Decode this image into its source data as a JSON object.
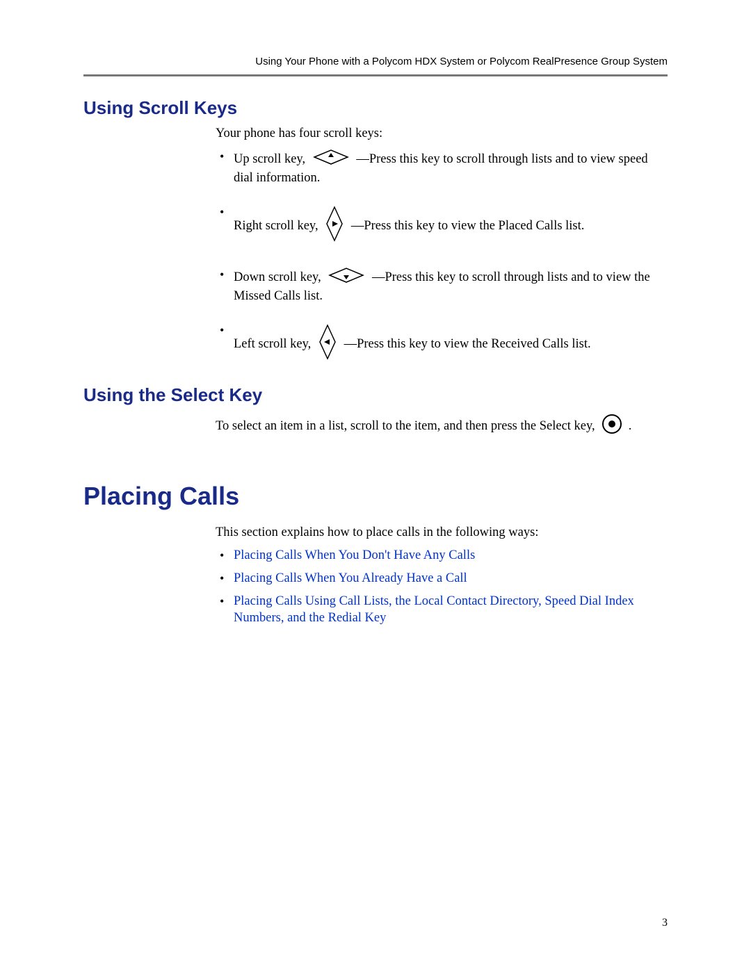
{
  "header": {
    "running_title": "Using Your Phone with a Polycom HDX System or Polycom RealPresence Group System"
  },
  "section_scroll": {
    "heading": "Using Scroll Keys",
    "intro": "Your phone has four scroll keys:",
    "items": [
      {
        "label_before": "Up scroll key,",
        "after": "—Press this key to scroll through lists and to view speed dial information."
      },
      {
        "label_before": "Right scroll key,",
        "after": "—Press this key to view the Placed Calls list."
      },
      {
        "label_before": "Down scroll key,",
        "after": "—Press this key to scroll through lists and to view the Missed Calls list."
      },
      {
        "label_before": "Left scroll key,",
        "after": "—Press this key to view the Received Calls list."
      }
    ]
  },
  "section_select": {
    "heading": "Using the Select Key",
    "text_before": "To select an item in a list, scroll to the item, and then press the Select key,",
    "text_after": "."
  },
  "section_placing": {
    "heading": "Placing Calls",
    "intro": "This section explains how to place calls in the following ways:",
    "links": [
      "Placing Calls When You Don't Have Any Calls",
      "Placing Calls When You Already Have a Call",
      "Placing Calls Using Call Lists, the Local Contact Directory, Speed Dial Index Numbers, and the Redial Key"
    ]
  },
  "page_number": "3"
}
